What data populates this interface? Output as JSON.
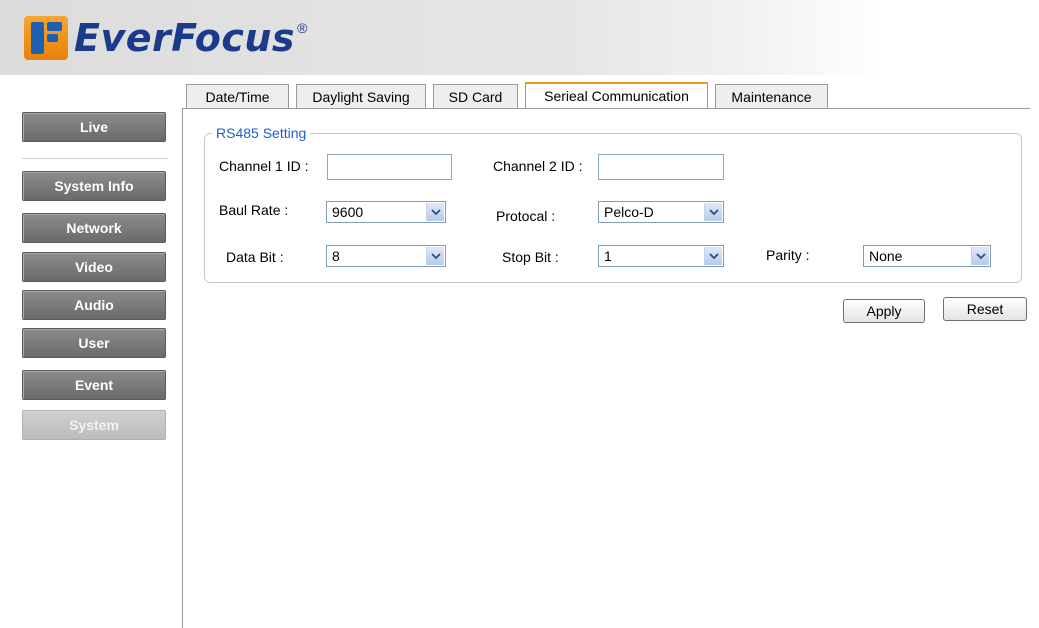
{
  "brand": {
    "name": "EverFocus",
    "registered": "®"
  },
  "sidebar": {
    "items": [
      {
        "label": "Live"
      },
      {
        "label": "System Info"
      },
      {
        "label": "Network"
      },
      {
        "label": "Video"
      },
      {
        "label": "Audio"
      },
      {
        "label": "User"
      },
      {
        "label": "Event"
      },
      {
        "label": "System",
        "active": true
      }
    ]
  },
  "tabs": [
    {
      "label": "Date/Time"
    },
    {
      "label": "Daylight Saving"
    },
    {
      "label": "SD Card"
    },
    {
      "label": "Serieal Communication",
      "active": true
    },
    {
      "label": "Maintenance"
    }
  ],
  "rs485": {
    "legend": "RS485 Setting",
    "channel1_label": "Channel 1 ID :",
    "channel1_value": "",
    "channel2_label": "Channel 2 ID :",
    "channel2_value": "",
    "baud_label": "Baul Rate :",
    "baud_value": "9600",
    "protocol_label": "Protocal :",
    "protocol_value": "Pelco-D",
    "databit_label": "Data Bit :",
    "databit_value": "8",
    "stopbit_label": "Stop Bit :",
    "stopbit_value": "1",
    "parity_label": "Parity :",
    "parity_value": "None"
  },
  "actions": {
    "apply": "Apply",
    "reset": "Reset"
  },
  "colors": {
    "accent_tab": "#e99a1c",
    "legend": "#1c5fd0",
    "nav_bg": "#7a7a7a",
    "nav_active": "#c6c6c6"
  },
  "icons": {
    "dropdown": "chevron-down-icon"
  }
}
